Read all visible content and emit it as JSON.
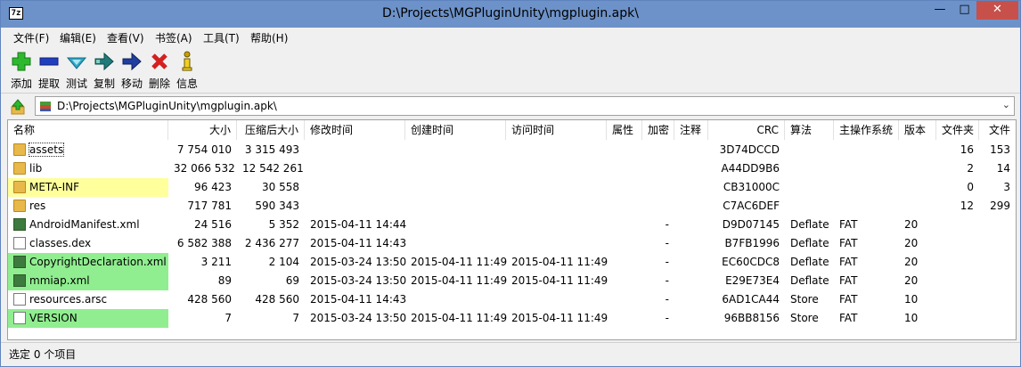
{
  "window": {
    "title": "D:\\Projects\\MGPluginUnity\\mgplugin.apk\\",
    "app_icon_text": "7z",
    "minimize_symbol": "—",
    "maximize_symbol": "□",
    "close_symbol": "✕"
  },
  "menu": [
    "文件(F)",
    "编辑(E)",
    "查看(V)",
    "书签(A)",
    "工具(T)",
    "帮助(H)"
  ],
  "toolbar": [
    {
      "label": "添加",
      "icon": "plus-icon",
      "color": "#2db82d"
    },
    {
      "label": "提取",
      "icon": "minus-icon",
      "color": "#1f3fbf"
    },
    {
      "label": "测试",
      "icon": "check-icon",
      "color": "#2aa8c8"
    },
    {
      "label": "复制",
      "icon": "copy-arrow-icon",
      "color": "#1f7a7a"
    },
    {
      "label": "移动",
      "icon": "move-arrow-icon",
      "color": "#1f3f9f"
    },
    {
      "label": "删除",
      "icon": "delete-x-icon",
      "color": "#d42020"
    },
    {
      "label": "信息",
      "icon": "info-icon",
      "color": "#c8a000"
    }
  ],
  "address": {
    "path": "D:\\Projects\\MGPluginUnity\\mgplugin.apk\\"
  },
  "columns": [
    "名称",
    "大小",
    "压缩后大小",
    "修改时间",
    "创建时间",
    "访问时间",
    "属性",
    "加密",
    "注释",
    "CRC",
    "算法",
    "主操作系统",
    "版本",
    "文件夹",
    "文件"
  ],
  "rows": [
    {
      "type": "folder",
      "name": "assets",
      "size": "7 754 010",
      "packed": "3 315 493",
      "modified": "",
      "created": "",
      "accessed": "",
      "attr": "",
      "enc": "",
      "comment": "",
      "crc": "3D74DCCD",
      "method": "",
      "os": "",
      "ver": "",
      "folders": "16",
      "files": "153",
      "highlight": "",
      "focused": true
    },
    {
      "type": "folder",
      "name": "lib",
      "size": "32 066 532",
      "packed": "12 542 261",
      "modified": "",
      "created": "",
      "accessed": "",
      "attr": "",
      "enc": "",
      "comment": "",
      "crc": "A44DD9B6",
      "method": "",
      "os": "",
      "ver": "",
      "folders": "2",
      "files": "14",
      "highlight": ""
    },
    {
      "type": "folder",
      "name": "META-INF",
      "size": "96 423",
      "packed": "30 558",
      "modified": "",
      "created": "",
      "accessed": "",
      "attr": "",
      "enc": "",
      "comment": "",
      "crc": "CB31000C",
      "method": "",
      "os": "",
      "ver": "",
      "folders": "0",
      "files": "3",
      "highlight": "yellow"
    },
    {
      "type": "folder",
      "name": "res",
      "size": "717 781",
      "packed": "590 343",
      "modified": "",
      "created": "",
      "accessed": "",
      "attr": "",
      "enc": "",
      "comment": "",
      "crc": "C7AC6DEF",
      "method": "",
      "os": "",
      "ver": "",
      "folders": "12",
      "files": "299",
      "highlight": ""
    },
    {
      "type": "xml",
      "name": "AndroidManifest.xml",
      "size": "24 516",
      "packed": "5 352",
      "modified": "2015-04-11 14:44",
      "created": "",
      "accessed": "",
      "attr": "",
      "enc": "-",
      "comment": "",
      "crc": "D9D07145",
      "method": "Deflate",
      "os": "FAT",
      "ver": "20",
      "folders": "",
      "files": "",
      "highlight": ""
    },
    {
      "type": "file",
      "name": "classes.dex",
      "size": "6 582 388",
      "packed": "2 436 277",
      "modified": "2015-04-11 14:43",
      "created": "",
      "accessed": "",
      "attr": "",
      "enc": "-",
      "comment": "",
      "crc": "B7FB1996",
      "method": "Deflate",
      "os": "FAT",
      "ver": "20",
      "folders": "",
      "files": "",
      "highlight": ""
    },
    {
      "type": "xml",
      "name": "CopyrightDeclaration.xml",
      "size": "3 211",
      "packed": "2 104",
      "modified": "2015-03-24 13:50",
      "created": "2015-04-11 11:49",
      "accessed": "2015-04-11 11:49",
      "attr": "",
      "enc": "-",
      "comment": "",
      "crc": "EC60CDC8",
      "method": "Deflate",
      "os": "FAT",
      "ver": "20",
      "folders": "",
      "files": "",
      "highlight": "green"
    },
    {
      "type": "xml",
      "name": "mmiap.xml",
      "size": "89",
      "packed": "69",
      "modified": "2015-03-24 13:50",
      "created": "2015-04-11 11:49",
      "accessed": "2015-04-11 11:49",
      "attr": "",
      "enc": "-",
      "comment": "",
      "crc": "E29E73E4",
      "method": "Deflate",
      "os": "FAT",
      "ver": "20",
      "folders": "",
      "files": "",
      "highlight": "green"
    },
    {
      "type": "file",
      "name": "resources.arsc",
      "size": "428 560",
      "packed": "428 560",
      "modified": "2015-04-11 14:43",
      "created": "",
      "accessed": "",
      "attr": "",
      "enc": "-",
      "comment": "",
      "crc": "6AD1CA44",
      "method": "Store",
      "os": "FAT",
      "ver": "10",
      "folders": "",
      "files": "",
      "highlight": ""
    },
    {
      "type": "file",
      "name": "VERSION",
      "size": "7",
      "packed": "7",
      "modified": "2015-03-24 13:50",
      "created": "2015-04-11 11:49",
      "accessed": "2015-04-11 11:49",
      "attr": "",
      "enc": "-",
      "comment": "",
      "crc": "96BB8156",
      "method": "Store",
      "os": "FAT",
      "ver": "10",
      "folders": "",
      "files": "",
      "highlight": "green"
    }
  ],
  "status": "选定 0 个项目"
}
